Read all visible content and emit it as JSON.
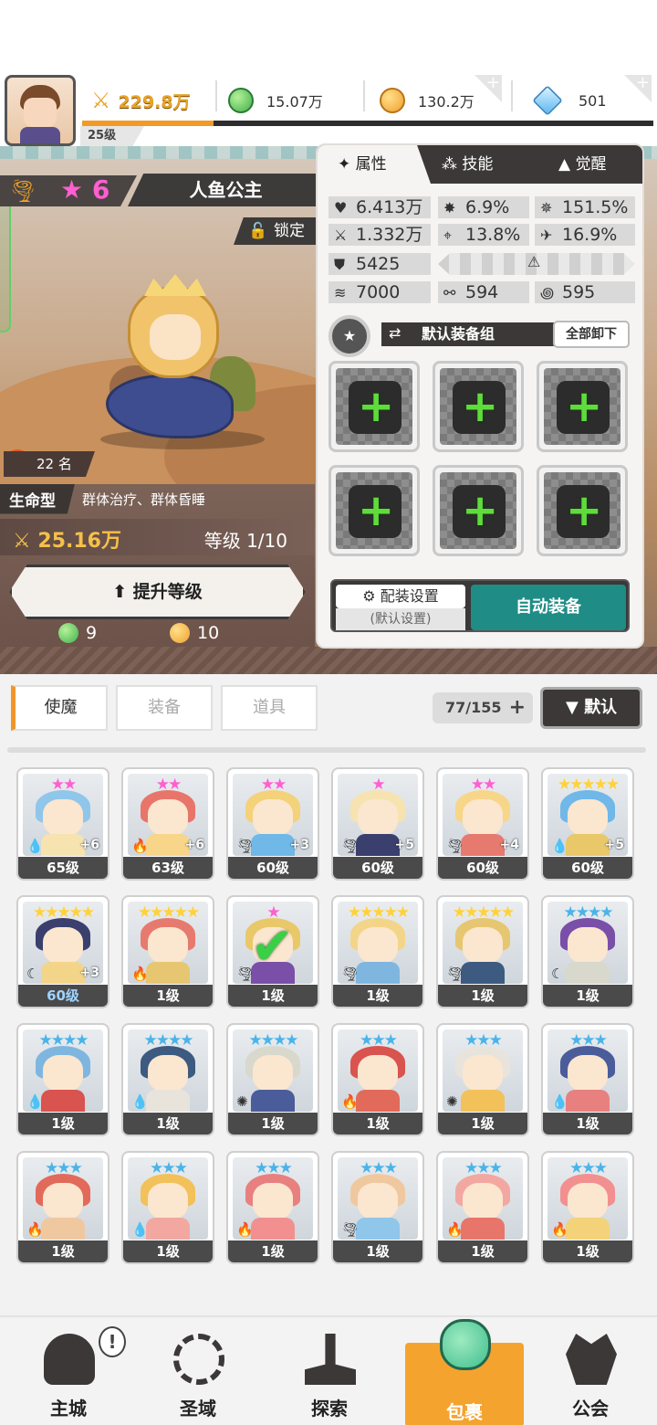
{
  "resources": {
    "power": "229.8万",
    "green_gem": "15.07万",
    "gold": "130.2万",
    "diamond": "501"
  },
  "player": {
    "level": "25级",
    "xp_fraction": 0.23
  },
  "hero": {
    "star_count": "6",
    "name": "人鱼公主",
    "lock_label": "锁定",
    "hot_rank": "22 名",
    "hot_icon": "热",
    "type": "生命型",
    "skills_desc": "群体治疗、群体昏睡",
    "power": "25.16万",
    "level_text": "等级 1/10",
    "upgrade_label": "提升等级",
    "cost_green": "9",
    "cost_gold": "10"
  },
  "panel": {
    "tabs": [
      {
        "label": "属性",
        "icon": "attributes-icon"
      },
      {
        "label": "技能",
        "icon": "skill-icon"
      },
      {
        "label": "觉醒",
        "icon": "awaken-icon"
      }
    ],
    "stats": {
      "hp": "6.413万",
      "crit": "6.9%",
      "crit_dmg": "151.5%",
      "atk": "1.332万",
      "hit": "13.8%",
      "dodge": "16.9%",
      "def": "5425",
      "speed": "7000",
      "res_a": "594",
      "res_b": "595"
    },
    "set_name": "默认装备组",
    "unequip_label": "全部卸下",
    "config_label": "配装设置",
    "config_sub": "(默认设置)",
    "auto_label": "自动装备"
  },
  "inventory": {
    "tabs": [
      "使魔",
      "装备",
      "道具"
    ],
    "count": "77/155",
    "sort_label": "默认",
    "cards": [
      {
        "level": "65级",
        "stars": "★★",
        "star_color": "#ff5fd0",
        "plus": "+6",
        "element": "water"
      },
      {
        "level": "63级",
        "stars": "★★",
        "star_color": "#ff5fd0",
        "plus": "+6",
        "element": "fire"
      },
      {
        "level": "60级",
        "stars": "★★",
        "star_color": "#ff5fd0",
        "plus": "+3",
        "element": "wind"
      },
      {
        "level": "60级",
        "stars": "★",
        "star_color": "#ff5fd0",
        "plus": "+5",
        "element": "wind"
      },
      {
        "level": "60级",
        "stars": "★★",
        "star_color": "#ff5fd0",
        "plus": "+4",
        "element": "wind"
      },
      {
        "level": "60级",
        "stars": "★★★★★",
        "star_color": "#ffd23a",
        "plus": "+5",
        "element": "water"
      },
      {
        "level": "60级",
        "stars": "★★★★★",
        "star_color": "#ffd23a",
        "plus": "+3",
        "element": "dark"
      },
      {
        "level": "1级",
        "stars": "★★★★★",
        "star_color": "#ffd23a",
        "plus": "",
        "element": "fire"
      },
      {
        "level": "1级",
        "stars": "★",
        "star_color": "#ff5fd0",
        "plus": "",
        "element": "wind"
      },
      {
        "level": "1级",
        "stars": "★★★★★",
        "star_color": "#ffd23a",
        "plus": "",
        "element": "wind"
      },
      {
        "level": "1级",
        "stars": "★★★★★",
        "star_color": "#ffd23a",
        "plus": "",
        "element": "wind"
      },
      {
        "level": "1级",
        "stars": "★★★★",
        "star_color": "#4ab4e8",
        "plus": "",
        "element": "dark"
      },
      {
        "level": "1级",
        "stars": "★★★★",
        "star_color": "#4ab4e8",
        "plus": "",
        "element": "water"
      },
      {
        "level": "1级",
        "stars": "★★★★",
        "star_color": "#4ab4e8",
        "plus": "",
        "element": "water"
      },
      {
        "level": "1级",
        "stars": "★★★★",
        "star_color": "#4ab4e8",
        "plus": "",
        "element": "light"
      },
      {
        "level": "1级",
        "stars": "★★★",
        "star_color": "#4ab4e8",
        "plus": "",
        "element": "fire"
      },
      {
        "level": "1级",
        "stars": "★★★",
        "star_color": "#4ab4e8",
        "plus": "",
        "element": "light"
      },
      {
        "level": "1级",
        "stars": "★★★",
        "star_color": "#4ab4e8",
        "plus": "",
        "element": "water"
      },
      {
        "level": "1级",
        "stars": "★★★",
        "star_color": "#4ab4e8",
        "plus": "",
        "element": "fire"
      },
      {
        "level": "1级",
        "stars": "★★★",
        "star_color": "#4ab4e8",
        "plus": "",
        "element": "water"
      },
      {
        "level": "1级",
        "stars": "★★★",
        "star_color": "#4ab4e8",
        "plus": "",
        "element": "fire"
      },
      {
        "level": "1级",
        "stars": "★★★",
        "star_color": "#4ab4e8",
        "plus": "",
        "element": "wind"
      },
      {
        "level": "1级",
        "stars": "★★★",
        "star_color": "#4ab4e8",
        "plus": "",
        "element": "fire"
      },
      {
        "level": "1级",
        "stars": "★★★",
        "star_color": "#4ab4e8",
        "plus": "",
        "element": "fire"
      }
    ]
  },
  "nav": [
    {
      "label": "主城",
      "icon": "castle-icon"
    },
    {
      "label": "圣域",
      "icon": "vortex-icon"
    },
    {
      "label": "探索",
      "icon": "sword-icon"
    },
    {
      "label": "包裹",
      "icon": "bag-icon"
    },
    {
      "label": "公会",
      "icon": "guild-icon"
    }
  ],
  "nav_badge": "!",
  "colors": {
    "accent": "#f4a32f",
    "teal": "#1f8c86",
    "panel_dark": "#3b3837"
  }
}
